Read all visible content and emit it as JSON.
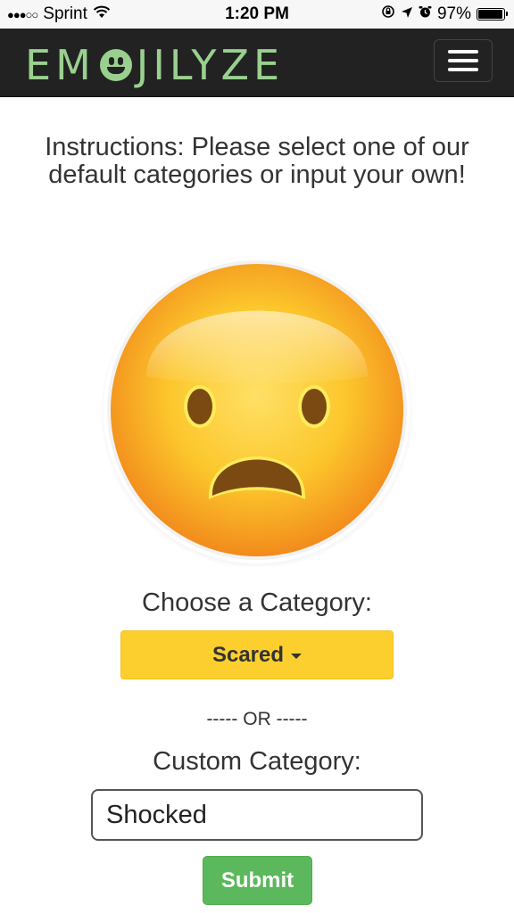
{
  "status_bar": {
    "signal_dots": "●●●○○",
    "carrier": "Sprint",
    "time": "1:20 PM",
    "battery_percent": "97%",
    "battery_level": 0.97
  },
  "navbar": {
    "logo_left": "EM",
    "logo_right": "JILYZE",
    "logo_color": "#9ad08f",
    "background": "#222222"
  },
  "main": {
    "instructions": "Instructions: Please select one of our default categories or input your own!",
    "emoji_icon": "anguished-face-icon",
    "category_label": "Choose a Category:",
    "selected_category": "Scared",
    "or_separator": "----- OR -----",
    "custom_label": "Custom Category:",
    "custom_value": "Shocked",
    "submit_label": "Submit"
  },
  "colors": {
    "dropdown": "#fdcf2e",
    "submit": "#5cb85c"
  }
}
